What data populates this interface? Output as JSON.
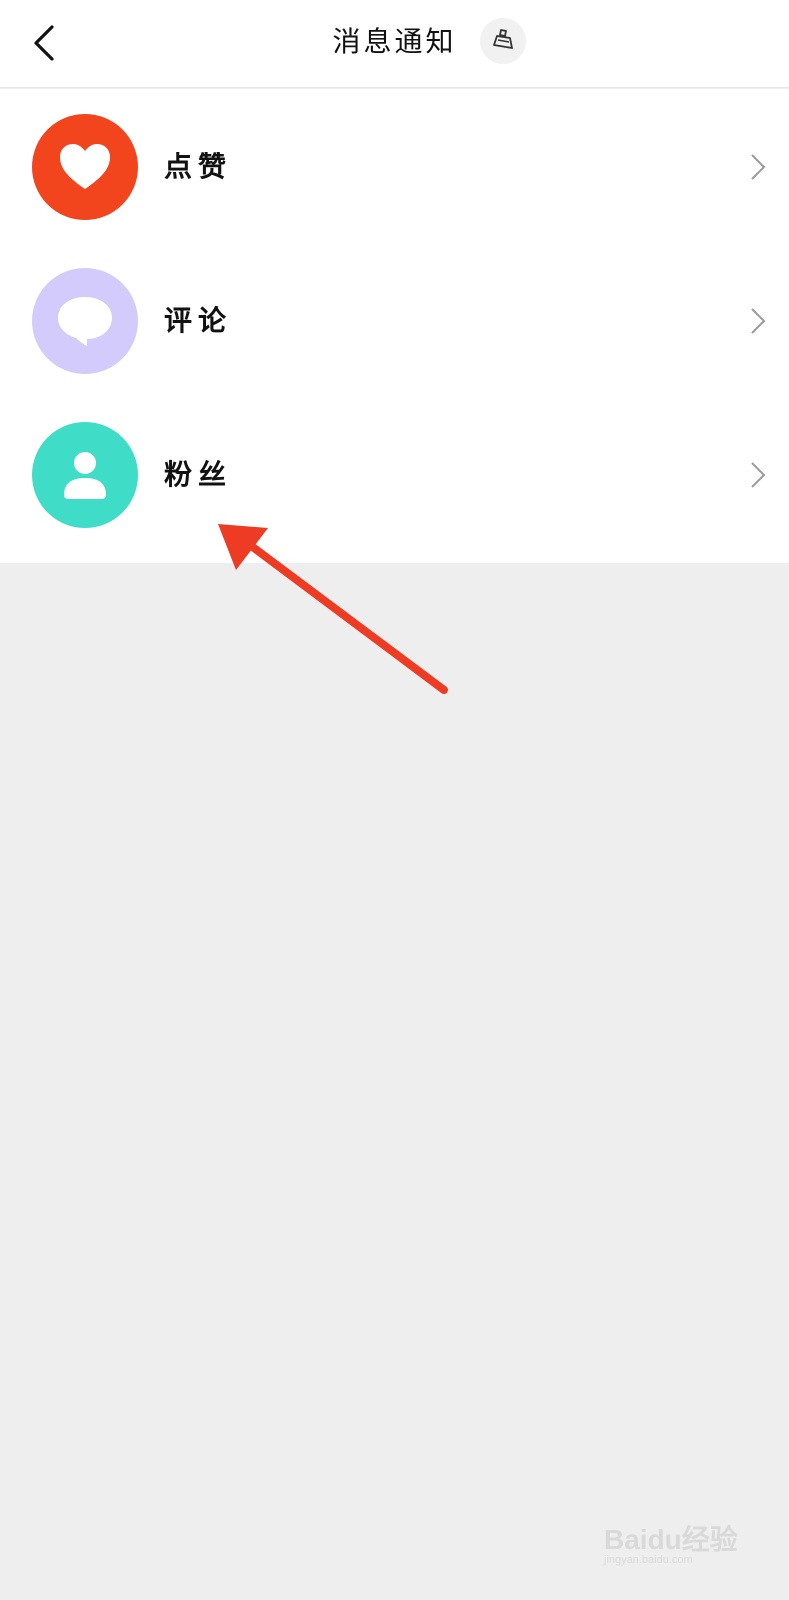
{
  "header": {
    "title": "消息通知",
    "back_icon": "chevron-left-icon",
    "clear_icon": "broom-icon"
  },
  "list": {
    "items": [
      {
        "label": "点赞",
        "icon": "heart-icon",
        "color": "#f2441d"
      },
      {
        "label": "评论",
        "icon": "speech-bubble-icon",
        "color": "#d3cbfb"
      },
      {
        "label": "粉丝",
        "icon": "person-icon",
        "color": "#3fdcc7"
      }
    ],
    "chevron_icon": "chevron-right-icon"
  },
  "annotation": {
    "arrow_color": "#ee3b24"
  },
  "watermark": {
    "brand": "Baidu经验",
    "url": "jingyan.baidu.com"
  }
}
